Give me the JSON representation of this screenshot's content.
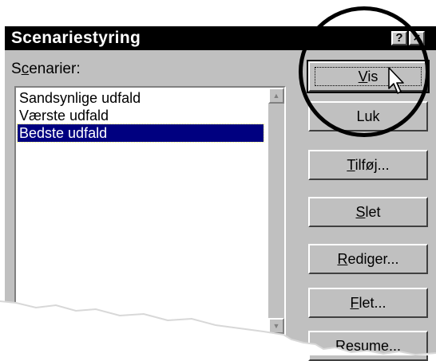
{
  "window": {
    "title": "Scenariestyring",
    "help_label": "?",
    "close_label": "×"
  },
  "scenarios": {
    "label_prefix": "S",
    "label_accel": "c",
    "label_rest": "enarier:",
    "items": [
      {
        "label": "Sandsynlige udfald",
        "selected": false
      },
      {
        "label": "Værste udfald",
        "selected": false
      },
      {
        "label": "Bedste udfald",
        "selected": true
      }
    ]
  },
  "buttons": {
    "vis": {
      "accel": "V",
      "rest": "is"
    },
    "luk": {
      "label": "Luk"
    },
    "tilfoj": {
      "accel": "T",
      "rest": "ilføj..."
    },
    "slet": {
      "accel": "S",
      "rest": "let"
    },
    "rediger": {
      "accel": "R",
      "rest": "ediger..."
    },
    "flet": {
      "accel": "F",
      "rest": "let..."
    },
    "resume": {
      "label": "Resume..."
    }
  },
  "icons": {
    "cursor": "mouse-pointer-icon",
    "scroll_up": "triangle-up-icon",
    "scroll_down": "triangle-down-icon"
  }
}
